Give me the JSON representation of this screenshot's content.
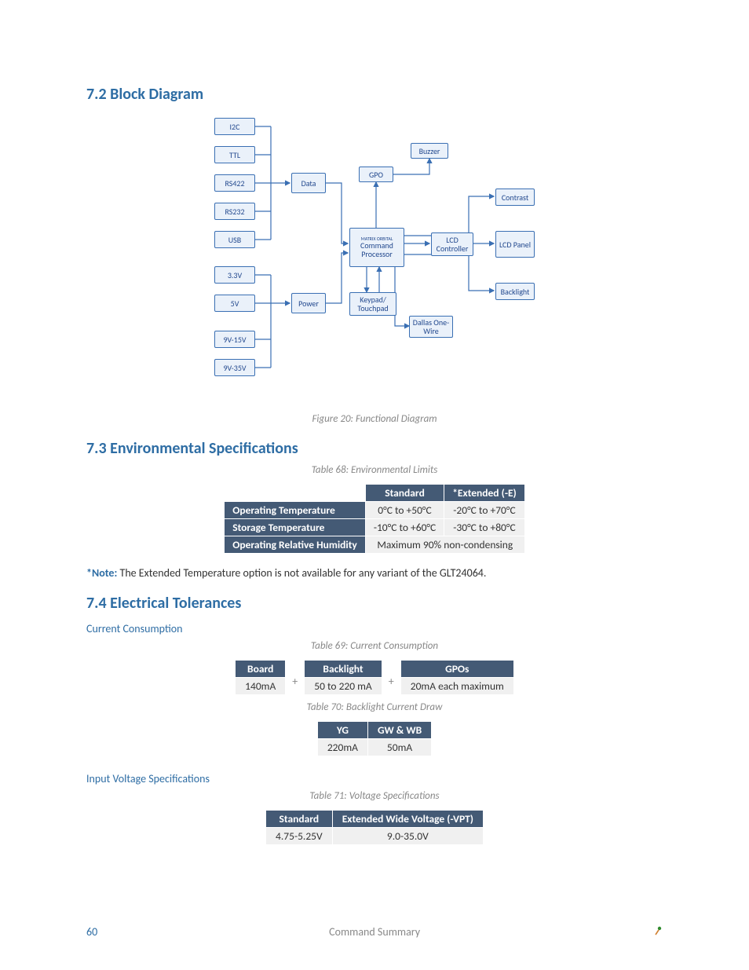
{
  "sections": {
    "s72": "7.2 Block Diagram",
    "s73": "7.3 Environmental Specifications",
    "s74": "7.4 Electrical Tolerances"
  },
  "captions": {
    "fig20": "Figure 20: Functional Diagram",
    "t68": "Table 68: Environmental Limits",
    "t69": "Table 69: Current Consumption",
    "t70": "Table 70: Backlight Current Draw",
    "t71": "Table 71: Voltage Specifications"
  },
  "diagram": {
    "inputs": [
      "I2C",
      "TTL",
      "RS422",
      "RS232",
      "USB",
      "3.3V",
      "5V",
      "9V-15V",
      "9V-35V"
    ],
    "data": "Data",
    "power": "Power",
    "gpo": "GPO",
    "buzzer": "Buzzer",
    "cmd_brand": "MATRIX ORBITAL",
    "cmd": "Command Processor",
    "keypad": "Keypad/ Touchpad",
    "dallas": "Dallas One-Wire",
    "lcd_ctrl": "LCD Controller",
    "lcd_panel": "LCD Panel",
    "contrast": "Contrast",
    "backlight": "Backlight"
  },
  "env_table": {
    "hdr_std": "Standard",
    "hdr_ext": "*Extended (-E)",
    "r1_label": "Operating Temperature",
    "r1_std": "0°C to +50°C",
    "r1_ext": "-20°C to +70°C",
    "r2_label": "Storage Temperature",
    "r2_std": "-10°C to +60°C",
    "r2_ext": "-30°C to +80°C",
    "r3_label": "Operating Relative Humidity",
    "r3_val": "Maximum 90% non-condensing"
  },
  "note": {
    "label": "*Note:",
    "text": " The Extended Temperature option is not available for any variant of the GLT24064."
  },
  "subheads": {
    "cc": "Current Consumption",
    "ivs": "Input Voltage Specifications"
  },
  "cc_table": {
    "plus": "+",
    "board_h": "Board",
    "board_v": "140mA",
    "bl_h": "Backlight",
    "bl_v": "50 to 220 mA",
    "gpo_h": "GPOs",
    "gpo_v": "20mA each maximum"
  },
  "bl_table": {
    "h1": "YG",
    "h2": "GW & WB",
    "v1": "220mA",
    "v2": "50mA"
  },
  "volt_table": {
    "h1": "Standard",
    "h2": "Extended Wide Voltage (-VPT)",
    "v1": "4.75-5.25V",
    "v2": "9.0-35.0V"
  },
  "footer": {
    "page": "60",
    "title": "Command Summary"
  }
}
